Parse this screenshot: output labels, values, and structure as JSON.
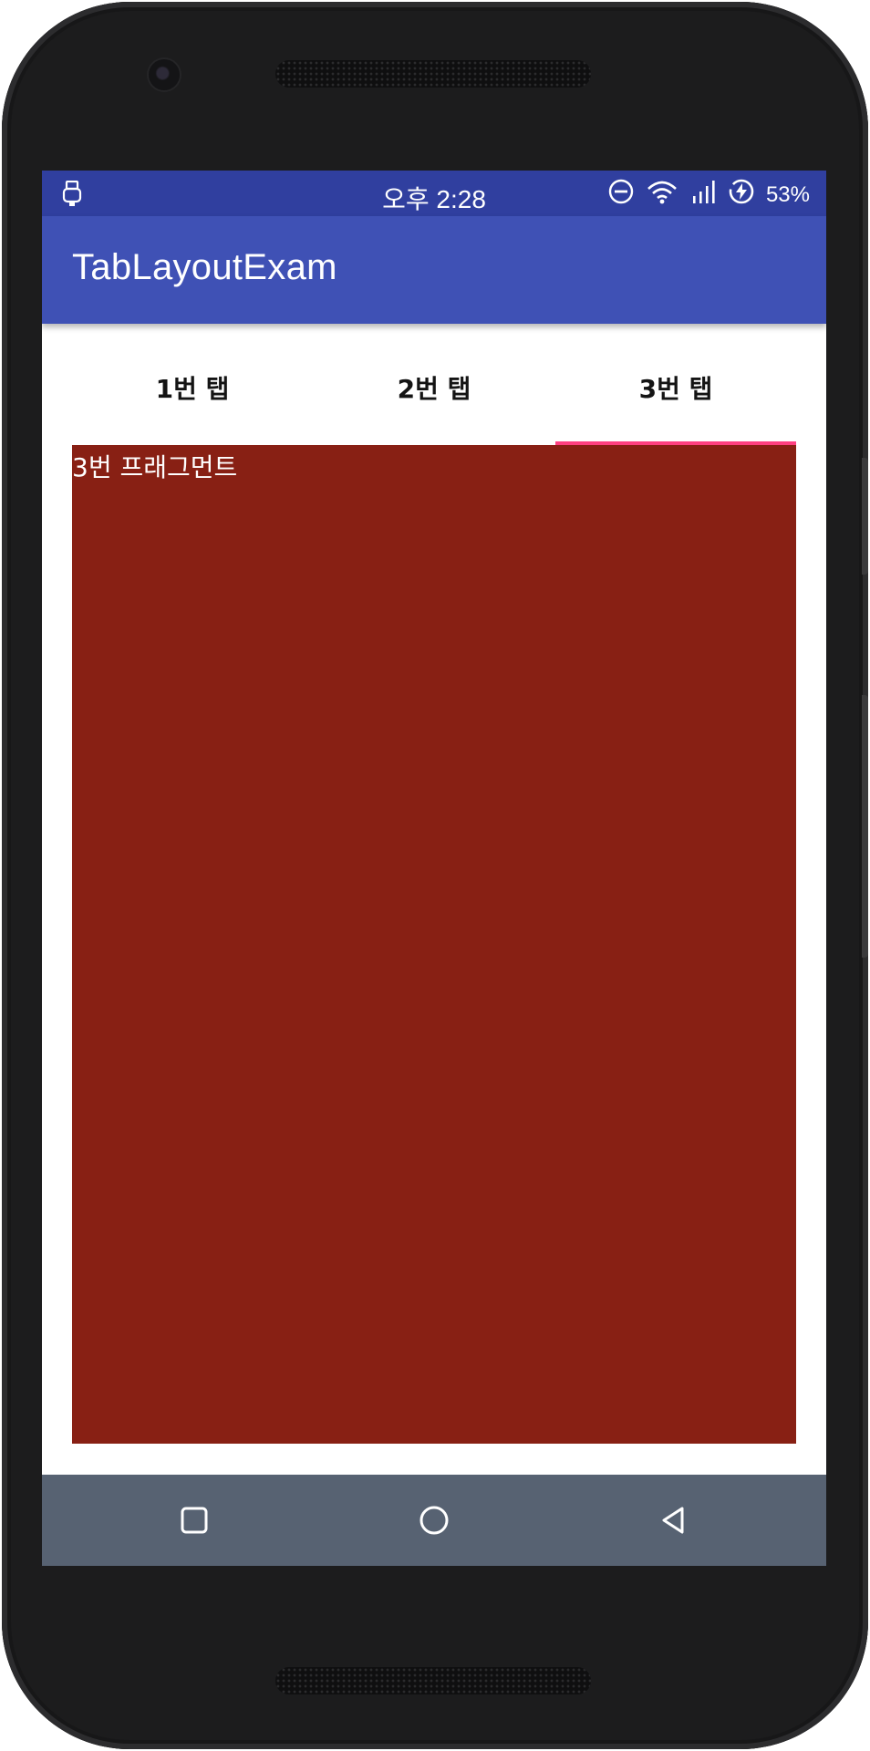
{
  "status_bar": {
    "time": "오후 2:28",
    "battery_percent": "53%",
    "icons": [
      "usb-icon",
      "do-not-disturb-icon",
      "wifi-icon",
      "signal-icon",
      "battery-charging-icon"
    ]
  },
  "app_bar": {
    "title": "TabLayoutExam"
  },
  "tabs": [
    {
      "label": "1번 탭",
      "selected": false
    },
    {
      "label": "2번 탭",
      "selected": false
    },
    {
      "label": "3번 탭",
      "selected": true
    }
  ],
  "content": {
    "text": "3번 프래그먼트",
    "background_color": "#882014"
  },
  "colors": {
    "status_bar": "#303f9f",
    "app_bar": "#3f51b5",
    "tab_indicator": "#ff4081",
    "nav_bar": "#576272"
  },
  "nav_bar": {
    "icons": [
      "recents-icon",
      "home-icon",
      "back-icon"
    ]
  }
}
